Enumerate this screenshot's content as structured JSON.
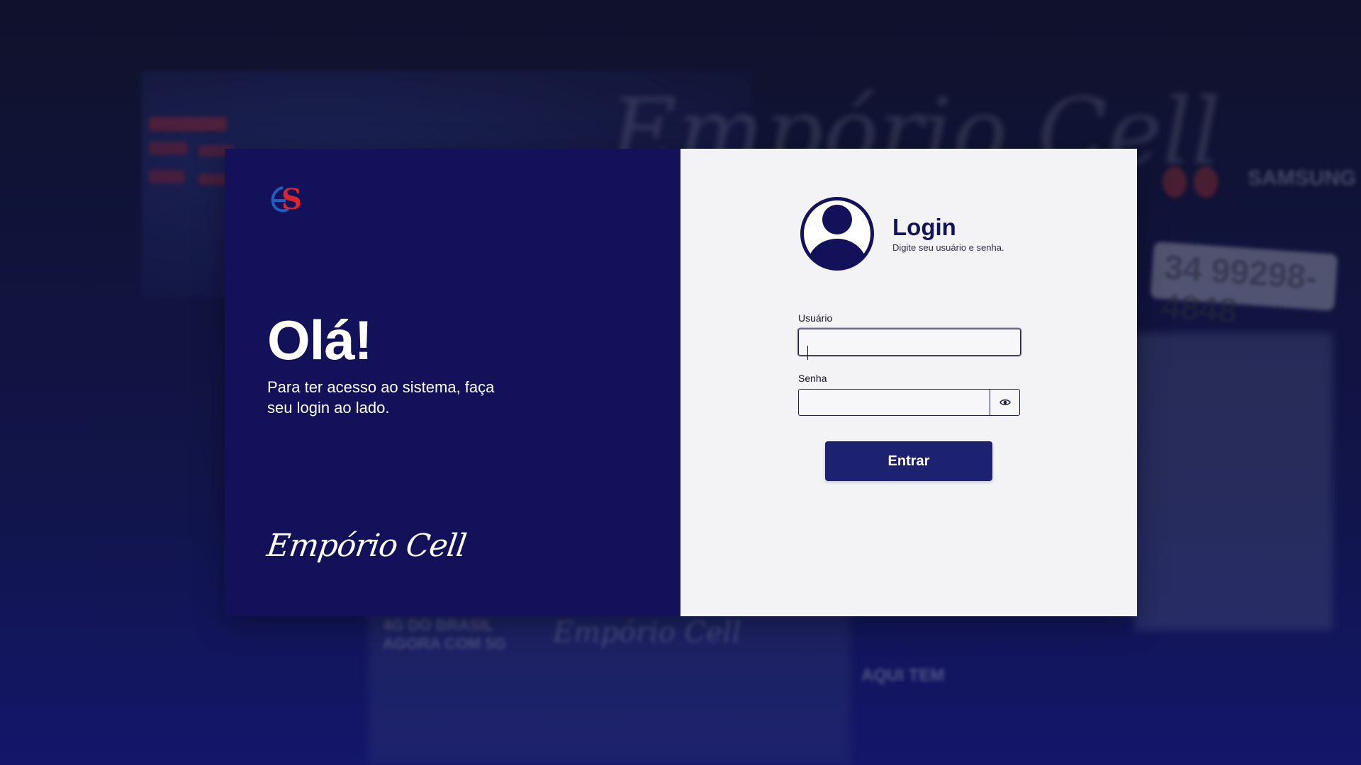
{
  "background": {
    "sign_phone": "34 99298-4848",
    "sign_brand": "SAMSUNG",
    "sign_banner": "4G DO BRASIL AGORA COM 5G",
    "sign_aqui_tem": "AQUI TEM",
    "colors": {
      "top": "#10122b",
      "bottom": "#13166a"
    }
  },
  "left_panel": {
    "logo_text": "ES",
    "title": "Olá!",
    "text": "Para ter acesso ao sistema, faça seu login ao lado.",
    "brand": "Empório Cell",
    "color": "#12115a"
  },
  "login": {
    "title": "Login",
    "subtitle": "Digite seu usuário e senha.",
    "user_label": "Usuário",
    "user_value": "",
    "password_label": "Senha",
    "password_value": "",
    "submit_label": "Entrar",
    "icons": {
      "avatar": "user-circle-icon",
      "toggle_password": "eye-icon"
    },
    "colors": {
      "accent": "#12115a",
      "button": "#1c2170",
      "panel": "#f3f3f5"
    }
  }
}
